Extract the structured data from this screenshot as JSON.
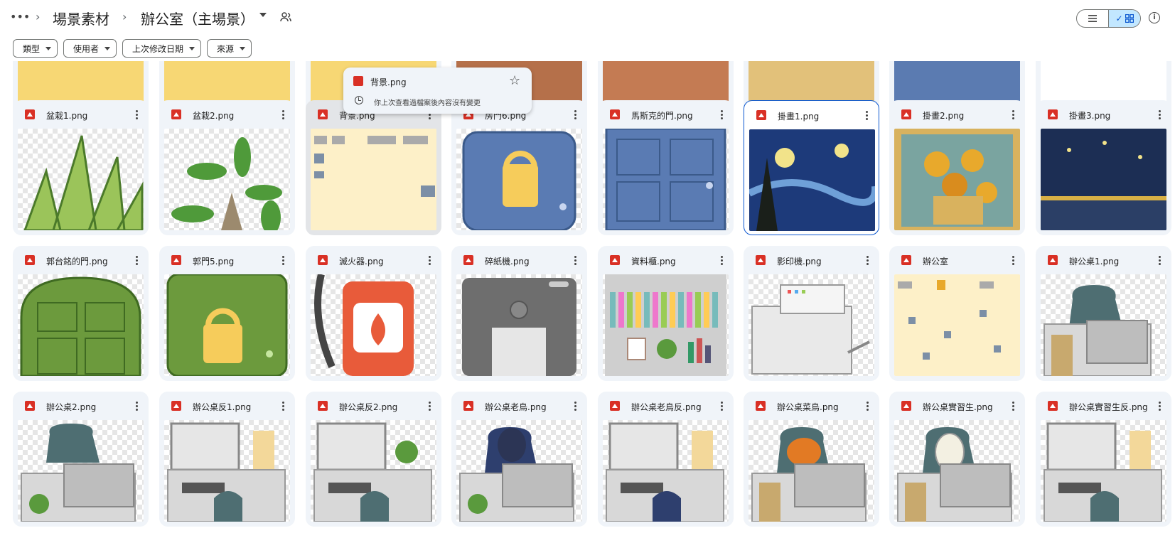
{
  "breadcrumb": {
    "more_label": "•••",
    "parent": "場景素材",
    "current": "辦公室（主場景）"
  },
  "toolbar": {
    "list_view_icon": "list-icon",
    "grid_view_icon": "grid-icon",
    "info_icon": "info-icon",
    "info_glyph": "i",
    "checkmark": "✓"
  },
  "filters": [
    {
      "label": "類型"
    },
    {
      "label": "使用者"
    },
    {
      "label": "上次修改日期"
    },
    {
      "label": "來源"
    }
  ],
  "tooltip": {
    "name": "背景.png",
    "star": "☆",
    "message": "你上次查看過檔案後內容沒有變更"
  },
  "rows": [
    {
      "files": [
        "",
        "",
        "",
        "",
        "",
        "",
        "",
        ""
      ]
    },
    {
      "files": [
        "盆栽1.png",
        "盆栽2.png",
        "背景.png",
        "房門6.png",
        "馬斯克的門.png",
        "掛畫1.png",
        "掛畫2.png",
        "掛畫3.png"
      ]
    },
    {
      "files": [
        "郭台銘的門.png",
        "郭門5.png",
        "滅火器.png",
        "碎紙機.png",
        "資料櫃.png",
        "影印機.png",
        "辦公室",
        "辦公桌1.png"
      ]
    },
    {
      "files": [
        "辦公桌2.png",
        "辦公桌反1.png",
        "辦公桌反2.png",
        "辦公桌老鳥.png",
        "辦公桌老鳥反.png",
        "辦公桌菜鳥.png",
        "辦公桌實習生.png",
        "辦公桌實習生反.png"
      ]
    }
  ],
  "colors": {
    "accent": "#0b57d0",
    "card_bg": "#f0f4f9",
    "file_icon": "#d93025"
  }
}
